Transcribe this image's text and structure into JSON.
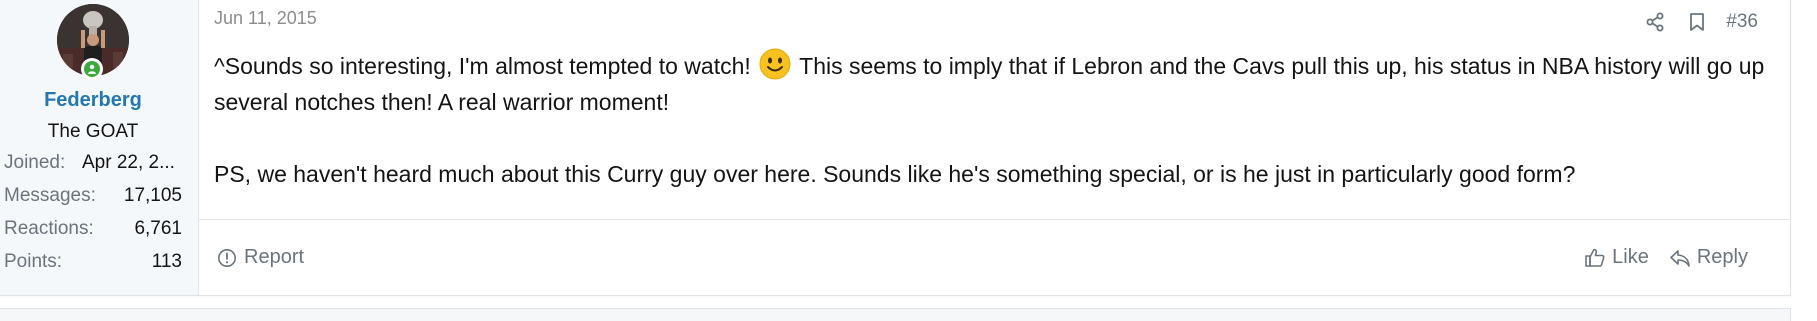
{
  "user": {
    "name": "Federberg",
    "title": "The GOAT",
    "stats": [
      {
        "label": "Joined:",
        "value": "Apr 22, 2..."
      },
      {
        "label": "Messages:",
        "value": "17,105"
      },
      {
        "label": "Reactions:",
        "value": "6,761"
      },
      {
        "label": "Points:",
        "value": "113"
      }
    ],
    "online": true
  },
  "post": {
    "date": "Jun 11, 2015",
    "number": "#36",
    "paragraph1_before": "^Sounds so interesting, I'm almost tempted to watch! ",
    "paragraph1_after": " This seems to imply that if Lebron and the Cavs pull this up, his status in NBA history will go up several notches then! A real warrior moment!",
    "paragraph2": "PS, we haven't heard much about this Curry guy over here. Sounds like he's something special, or is he just in particularly good form?"
  },
  "actions": {
    "report": "Report",
    "like": "Like",
    "reply": "Reply"
  },
  "icons": {
    "share": "share-icon",
    "bookmark": "bookmark-icon",
    "report": "report-icon",
    "like": "thumbs-up-icon",
    "reply": "reply-icon",
    "smilie": "smile-emoji-icon"
  },
  "colors": {
    "username": "#2577b1",
    "online": "#3cab3c",
    "muted": "#6b747d"
  }
}
